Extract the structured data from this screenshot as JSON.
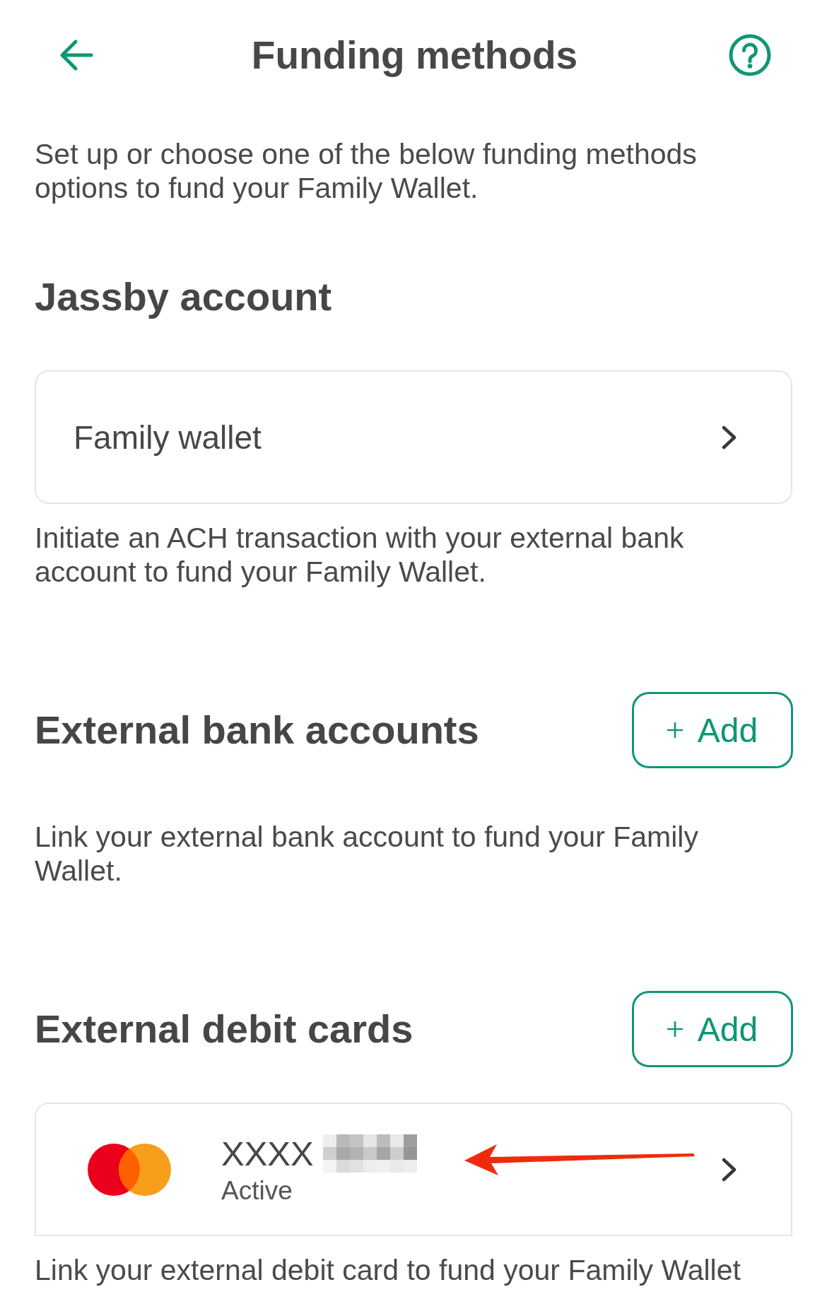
{
  "header": {
    "title": "Funding methods"
  },
  "intro": "Set up or choose one of the below funding methods options to fund your Family Wallet.",
  "sections": [
    {
      "heading": "Jassby account",
      "items": [
        {
          "kind": "wallet",
          "label": "Family wallet"
        }
      ],
      "description": "Initiate an ACH transaction with your external bank account to fund your Family Wallet."
    },
    {
      "heading": "External bank accounts",
      "add_button": {
        "label": "Add"
      },
      "description": "Link your external bank account to fund your Family Wallet."
    },
    {
      "heading": "External debit cards",
      "add_button": {
        "label": "Add"
      },
      "items": [
        {
          "kind": "card",
          "number": "XXXX",
          "status": "Active"
        }
      ],
      "description": "Link your external debit card to fund your Family Wallet"
    }
  ]
}
